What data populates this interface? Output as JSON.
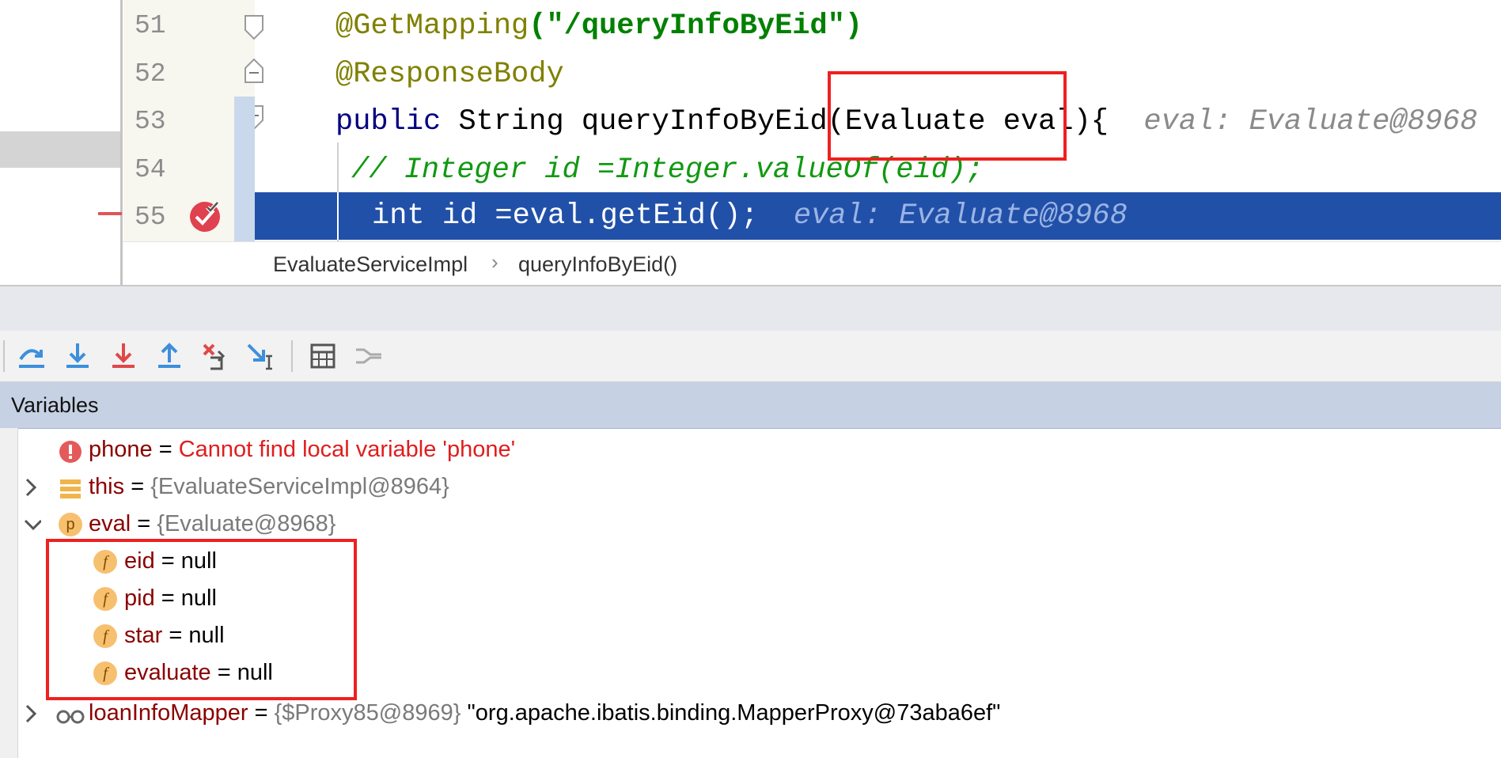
{
  "editor": {
    "lines": [
      {
        "number": "51",
        "code_prefix": "    ",
        "annotation": "@GetMapping",
        "string_literal": "(\"/queryInfoByEid\")"
      },
      {
        "number": "52",
        "annotation": "@ResponseBody"
      },
      {
        "number": "53",
        "kw": "public",
        "code_a": " String queryInfoByEid(",
        "code_b": "Evaluate eval",
        "code_c": "){",
        "hint": "eval: Evaluate@8968"
      },
      {
        "number": "54",
        "comment": "// Integer id =Integer.valueOf(eid);"
      },
      {
        "number": "55",
        "code": "int id =eval.getEid();",
        "hint": "eval: Evaluate@8968"
      }
    ],
    "breadcrumb": {
      "class": "EvaluateServiceImpl",
      "method": "queryInfoByEid()"
    }
  },
  "toolbar": {
    "buttons": [
      "show-execution-point-icon",
      "step-over-icon",
      "step-into-icon",
      "force-step-into-icon",
      "step-out-icon",
      "drop-frame-icon",
      "run-to-cursor-icon",
      "evaluate-expression-icon",
      "trace-current-stream-icon"
    ]
  },
  "variables": {
    "title": "Variables",
    "rows": [
      {
        "name": "phone",
        "op": " = ",
        "value": "Cannot find local variable 'phone'"
      },
      {
        "name": "this",
        "op": " = ",
        "value": "{EvaluateServiceImpl@8964}"
      },
      {
        "name": "eval",
        "op": " = ",
        "value": "{Evaluate@8968}"
      },
      {
        "name": "eid",
        "op": " = ",
        "value": "null"
      },
      {
        "name": "pid",
        "op": " = ",
        "value": "null"
      },
      {
        "name": "star",
        "op": " = ",
        "value": "null"
      },
      {
        "name": "evaluate",
        "op": " = ",
        "value": "null"
      },
      {
        "name": "loanInfoMapper",
        "op": " = ",
        "value": "{$Proxy85@8969}",
        "string": " \"org.apache.ibatis.binding.MapperProxy@73aba6ef\""
      }
    ],
    "icon_letters": {
      "p": "p",
      "f": "f"
    }
  },
  "colors": {
    "annotation_box": "#ee2020",
    "execution_line": "#2150a9",
    "variables_header": "#c6d1e3"
  }
}
